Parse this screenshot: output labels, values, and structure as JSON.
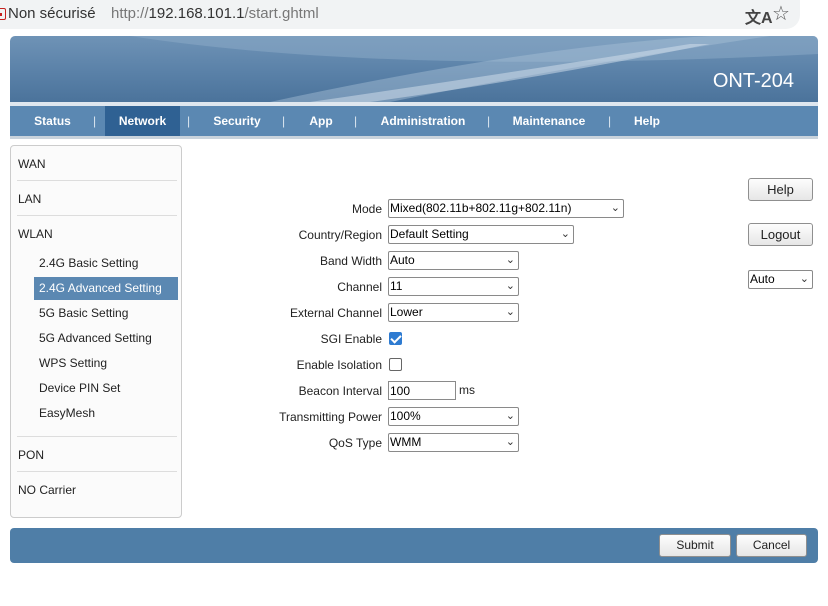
{
  "browser": {
    "security_label": "Non sécurisé",
    "url_scheme": "http://",
    "url_host": "192.168.101.1",
    "url_path": "/start.ghtml",
    "translate_icon": "translate-icon",
    "bookmark_icon": "star-icon"
  },
  "banner": {
    "device_name": "ONT-204"
  },
  "nav": {
    "items": [
      "Status",
      "Network",
      "Security",
      "App",
      "Administration",
      "Maintenance",
      "Help"
    ],
    "active": "Network",
    "separator": "|"
  },
  "sidebar": {
    "wan": "WAN",
    "lan": "LAN",
    "wlan": "WLAN",
    "wlan_items": [
      "2.4G Basic Setting",
      "2.4G Advanced Setting",
      "5G Basic Setting",
      "5G Advanced Setting",
      "WPS Setting",
      "Device PIN Set",
      "EasyMesh"
    ],
    "active": "2.4G Advanced Setting",
    "pon": "PON",
    "no_carrier": "NO Carrier"
  },
  "form": {
    "mode": {
      "label": "Mode",
      "value": "Mixed(802.11b+802.11g+802.11n)"
    },
    "country": {
      "label": "Country/Region",
      "value": "Default Setting"
    },
    "bandwidth": {
      "label": "Band Width",
      "value": "Auto"
    },
    "channel": {
      "label": "Channel",
      "value": "11"
    },
    "ext_channel": {
      "label": "External Channel",
      "value": "Lower"
    },
    "sgi": {
      "label": "SGI Enable",
      "checked": true
    },
    "isolation": {
      "label": "Enable Isolation",
      "checked": false
    },
    "beacon": {
      "label": "Beacon Interval",
      "value": "100",
      "unit": "ms"
    },
    "tx_power": {
      "label": "Transmitting Power",
      "value": "100%"
    },
    "qos": {
      "label": "QoS Type",
      "value": "WMM"
    }
  },
  "side_panel": {
    "help": "Help",
    "logout": "Logout",
    "language": "Auto"
  },
  "footer": {
    "submit": "Submit",
    "cancel": "Cancel"
  },
  "colors": {
    "nav": "#5b88b2",
    "nav_active": "#2f6193",
    "footer": "#4f7ea7",
    "checkbox": "#2e7bd1"
  }
}
